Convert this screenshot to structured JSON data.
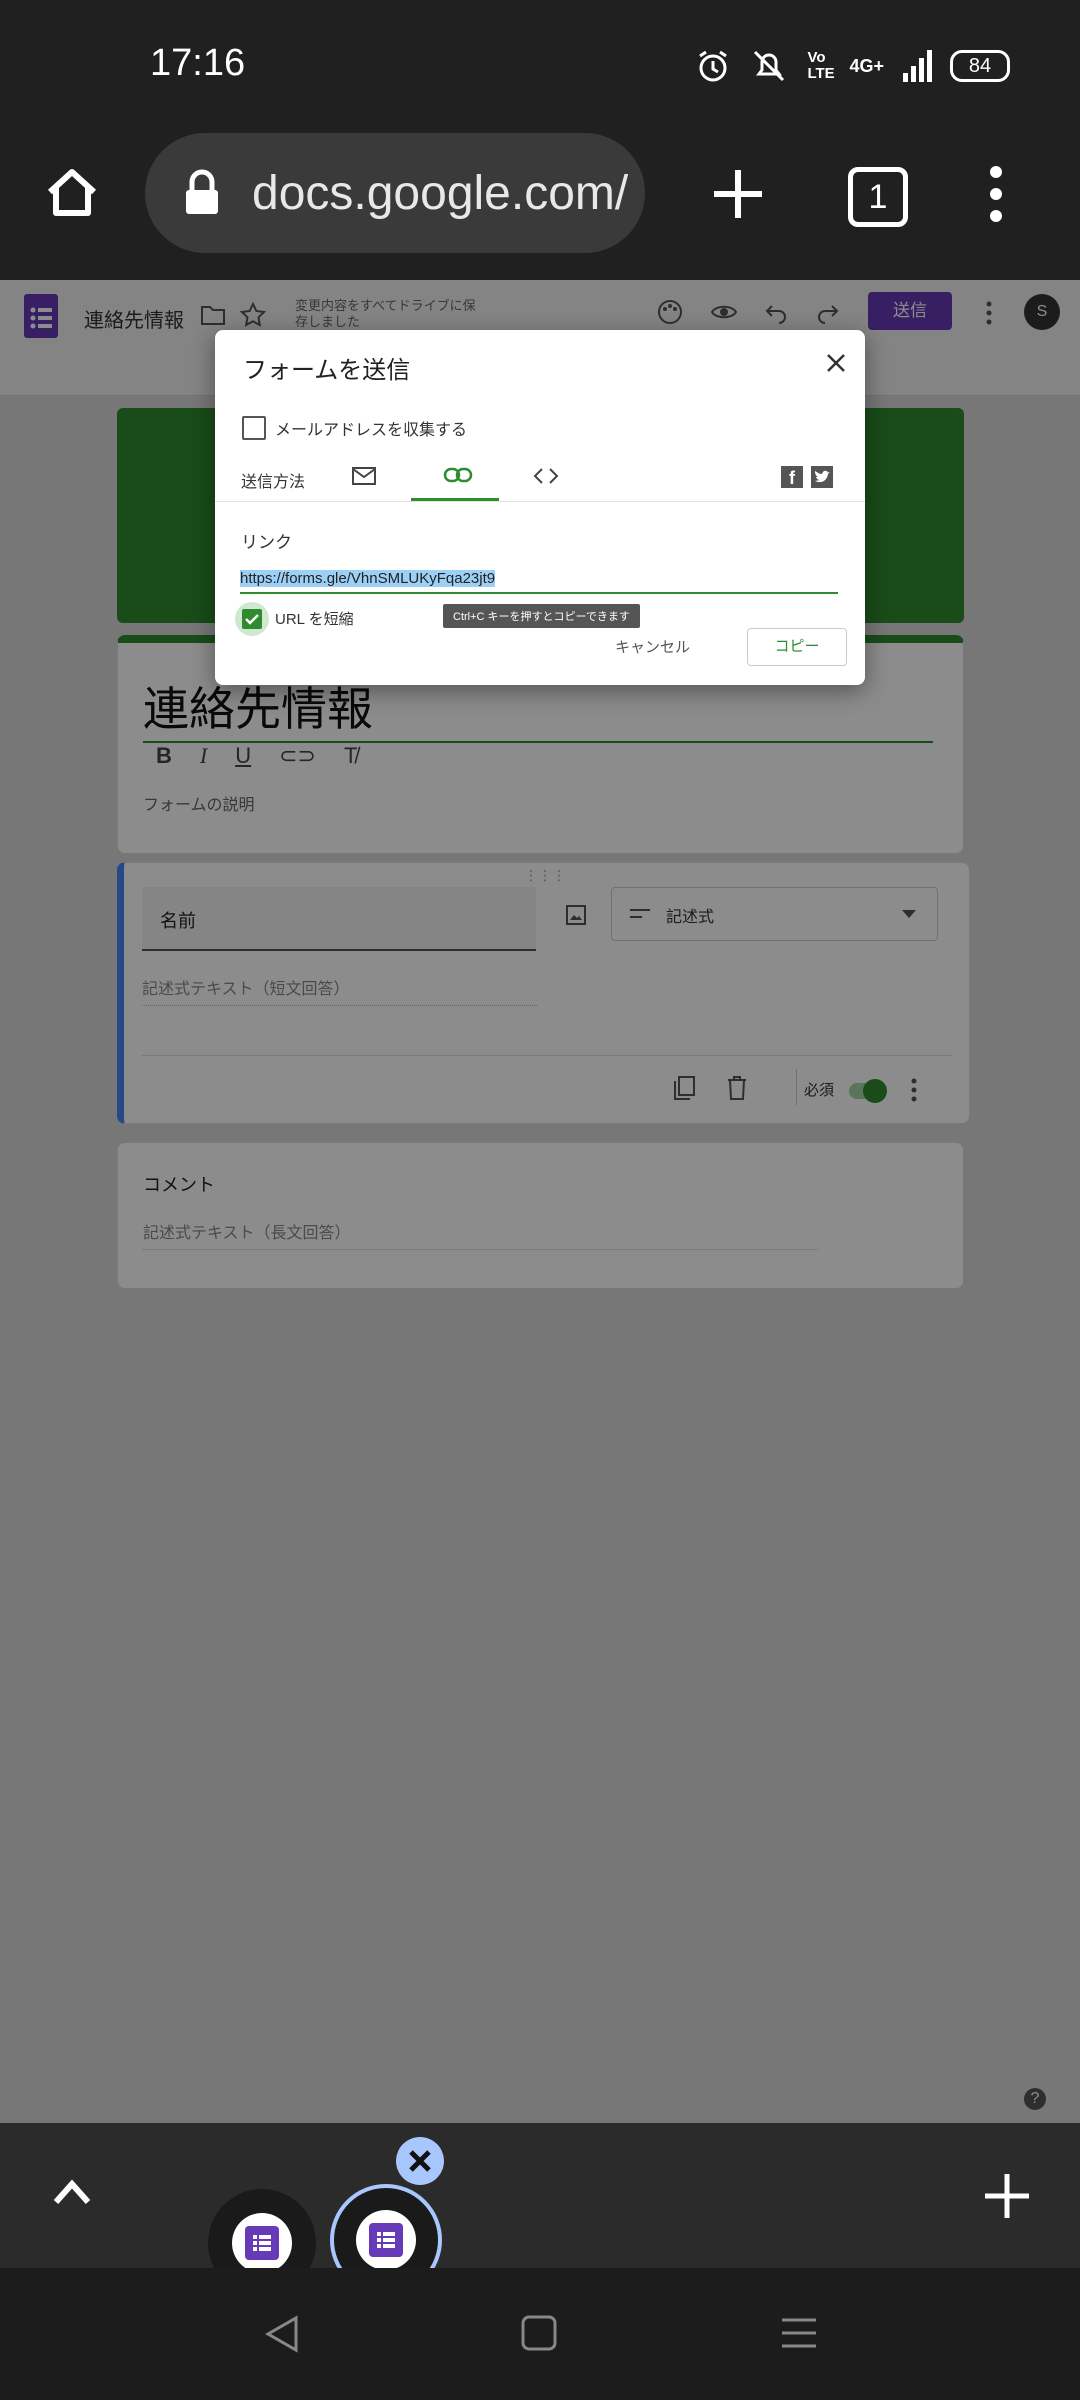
{
  "status_bar": {
    "time": "17:16",
    "network": "4G+",
    "volte": "Vo LTE",
    "battery": "84"
  },
  "browser": {
    "url": "docs.google.com/",
    "tab_count": "1"
  },
  "forms_header": {
    "doc_title": "連絡先情報",
    "save_status": "変更内容をすべてドライブに保存しました",
    "send_label": "送信",
    "avatar_initial": "S"
  },
  "form": {
    "title": "連絡先情報",
    "description_placeholder": "フォームの説明",
    "question1": {
      "title": "名前",
      "answer_hint": "記述式テキスト（短文回答）",
      "type_label": "記述式",
      "required_label": "必須"
    },
    "question2": {
      "title": "コメント",
      "answer_hint": "記述式テキスト（長文回答）"
    }
  },
  "dialog": {
    "title": "フォームを送信",
    "collect_email_label": "メールアドレスを収集する",
    "send_via_label": "送信方法",
    "link_heading": "リンク",
    "link_url": "https://forms.gle/VhnSMLUKyFqa23jt9",
    "shorten_label": "URL を短縮",
    "tooltip": "Ctrl+C キーを押すとコピーできます",
    "cancel_label": "キャンセル",
    "copy_label": "コピー"
  },
  "colors": {
    "accent_green": "#2e8b2e",
    "forms_purple": "#673ab7",
    "question_blue": "#4285f4"
  }
}
